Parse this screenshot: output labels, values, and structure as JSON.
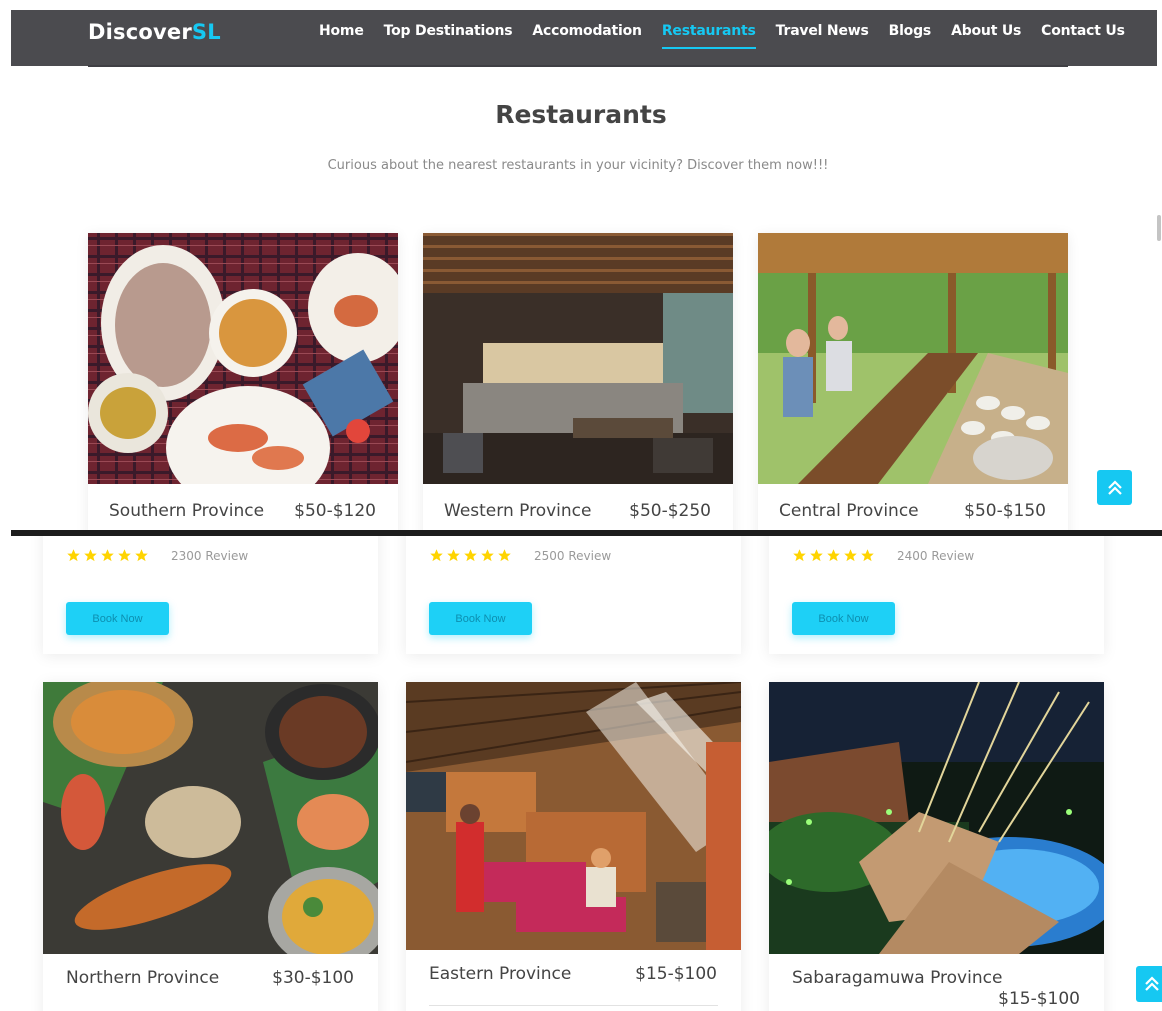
{
  "header": {
    "logo_main": "Discover",
    "logo_accent": "SL",
    "nav": [
      {
        "label": "Home"
      },
      {
        "label": "Top Destinations"
      },
      {
        "label": "Accomodation"
      },
      {
        "label": "Restaurants"
      },
      {
        "label": "Travel News"
      },
      {
        "label": "Blogs"
      },
      {
        "label": "About Us"
      },
      {
        "label": "Contact Us"
      }
    ]
  },
  "section": {
    "title": "Restaurants",
    "subtitle": "Curious about the nearest restaurants in your vicinity? Discover them now!!!"
  },
  "row1": [
    {
      "name": "Southern Province",
      "price": "$50-$120",
      "image": "plates-of-prawns-and-rice"
    },
    {
      "name": "Western Province",
      "price": "$50-$250",
      "image": "modern-restaurant-interior"
    },
    {
      "name": "Central Province",
      "price": "$50-$150",
      "image": "outdoor-buffet-diners"
    }
  ],
  "row1_details": [
    {
      "rating": 5,
      "reviews": "2300 Review",
      "button": "Book Now"
    },
    {
      "rating": 5,
      "reviews": "2500 Review",
      "button": "Book Now"
    },
    {
      "rating": 5,
      "reviews": "2400 Review",
      "button": "Book Now"
    }
  ],
  "row2": [
    {
      "name": "Northern Province",
      "price": "$30-$100",
      "image": "seafood-spread"
    },
    {
      "name": "Eastern Province",
      "price": "$15-$100",
      "image": "thatched-roof-dining-hall"
    },
    {
      "name": "Sabaragamuwa Province",
      "price": "$15-$100",
      "image": "night-resort-pool"
    }
  ],
  "colors": {
    "accent": "#16c8f2",
    "navbar": "#4b4b4f",
    "star": "#ffd400",
    "button": "#1ed0f6"
  }
}
